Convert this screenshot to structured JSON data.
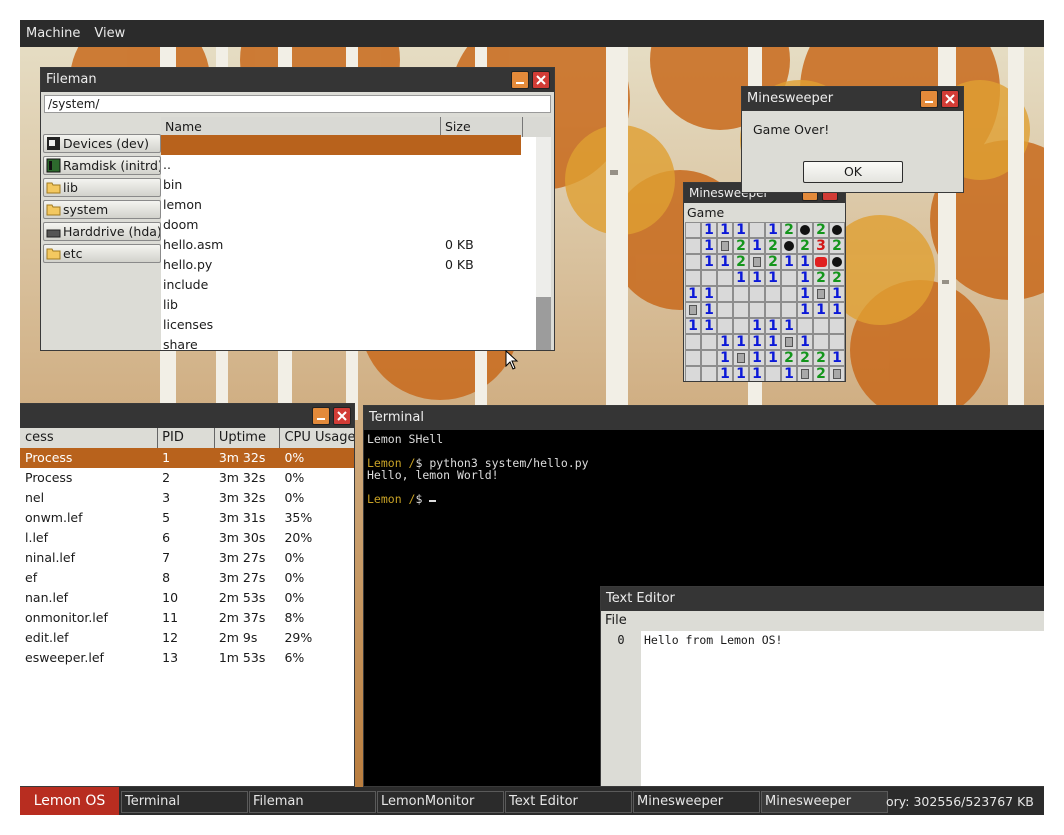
{
  "menubar": {
    "items": [
      "Machine",
      "View"
    ]
  },
  "fileman": {
    "title": "Fileman",
    "path": "/system/",
    "columns": [
      "Name",
      "Size"
    ],
    "sidebar": [
      {
        "label": "Devices (dev)",
        "icon": "device-icon"
      },
      {
        "label": "Ramdisk (initrd)",
        "icon": "chip-icon"
      },
      {
        "label": "lib",
        "icon": "folder-icon"
      },
      {
        "label": "system",
        "icon": "folder-icon"
      },
      {
        "label": "Harddrive (hda)",
        "icon": "drive-icon"
      },
      {
        "label": "etc",
        "icon": "folder-icon"
      }
    ],
    "files": [
      {
        "name": "",
        "size": ""
      },
      {
        "name": "..",
        "size": ""
      },
      {
        "name": "bin",
        "size": ""
      },
      {
        "name": "lemon",
        "size": ""
      },
      {
        "name": "doom",
        "size": ""
      },
      {
        "name": "hello.asm",
        "size": "0 KB"
      },
      {
        "name": "hello.py",
        "size": "0 KB"
      },
      {
        "name": "include",
        "size": ""
      },
      {
        "name": "lib",
        "size": ""
      },
      {
        "name": "licenses",
        "size": ""
      },
      {
        "name": "share",
        "size": ""
      }
    ]
  },
  "dialog": {
    "title": "Minesweeper",
    "message": "Game Over!",
    "ok_label": "OK"
  },
  "minesweeper": {
    "title": "Minesweeper",
    "menu": "Game",
    "grid": [
      [
        "_",
        "1",
        "1",
        "1",
        "_",
        "1",
        "2",
        "*",
        "2",
        "*"
      ],
      [
        "_",
        "1",
        "F",
        "2",
        "1",
        "2",
        "*",
        "2",
        "3",
        "2"
      ],
      [
        "_",
        "1",
        "1",
        "2",
        "F",
        "2",
        "1",
        "1",
        "X",
        "*"
      ],
      [
        "_",
        "_",
        "_",
        "1",
        "1",
        "1",
        "_",
        "1",
        "2",
        "2"
      ],
      [
        "1",
        "1",
        "_",
        "_",
        "_",
        "_",
        "_",
        "1",
        "F",
        "1"
      ],
      [
        "F",
        "1",
        "_",
        "_",
        "_",
        "_",
        "_",
        "1",
        "1",
        "1"
      ],
      [
        "1",
        "1",
        "_",
        "_",
        "1",
        "1",
        "1",
        "_",
        "_",
        "_"
      ],
      [
        "_",
        "_",
        "1",
        "1",
        "1",
        "1",
        "F",
        "1",
        "_",
        "_"
      ],
      [
        "_",
        "_",
        "1",
        "F",
        "1",
        "1",
        "2",
        "2",
        "2",
        "1"
      ],
      [
        "_",
        "_",
        "1",
        "1",
        "1",
        "_",
        "1",
        "F",
        "2",
        "F"
      ]
    ]
  },
  "monitor": {
    "columns": [
      "cess",
      "PID",
      "Uptime",
      "CPU Usage"
    ],
    "rows": [
      {
        "name": "Process",
        "pid": "1",
        "uptime": "3m 32s",
        "cpu": "0%"
      },
      {
        "name": "Process",
        "pid": "2",
        "uptime": "3m 32s",
        "cpu": "0%"
      },
      {
        "name": "nel",
        "pid": "3",
        "uptime": "3m 32s",
        "cpu": "0%"
      },
      {
        "name": "onwm.lef",
        "pid": "5",
        "uptime": "3m 31s",
        "cpu": "35%"
      },
      {
        "name": "l.lef",
        "pid": "6",
        "uptime": "3m 30s",
        "cpu": "20%"
      },
      {
        "name": "ninal.lef",
        "pid": "7",
        "uptime": "3m 27s",
        "cpu": "0%"
      },
      {
        "name": "ef",
        "pid": "8",
        "uptime": "3m 27s",
        "cpu": "0%"
      },
      {
        "name": "nan.lef",
        "pid": "10",
        "uptime": "2m 53s",
        "cpu": "0%"
      },
      {
        "name": "onmonitor.lef",
        "pid": "11",
        "uptime": "2m 37s",
        "cpu": "8%"
      },
      {
        "name": "edit.lef",
        "pid": "12",
        "uptime": "2m 9s",
        "cpu": "29%"
      },
      {
        "name": "esweeper.lef",
        "pid": "13",
        "uptime": "1m 53s",
        "cpu": "6%"
      }
    ]
  },
  "terminal": {
    "title": "Terminal",
    "banner": "Lemon SHell",
    "prompt1": "Lemon /",
    "cmd": "$ python3 system/hello.py",
    "output": "Hello, lemon World!",
    "prompt2": "Lemon /",
    "prompt2_tail": "$ "
  },
  "editor": {
    "title": "Text Editor",
    "menu": "File",
    "line_no": "0",
    "content": "Hello from Lemon OS!"
  },
  "taskbar": {
    "start": "Lemon OS",
    "tasks": [
      "Terminal",
      "Fileman",
      "LemonMonitor",
      "Text Editor",
      "Minesweeper",
      "Minesweeper"
    ],
    "memory": "ory: 302556/523767 KB"
  },
  "colors": {
    "accent": "#b8621c",
    "start": "#b82d20",
    "titlebar": "#353535"
  }
}
